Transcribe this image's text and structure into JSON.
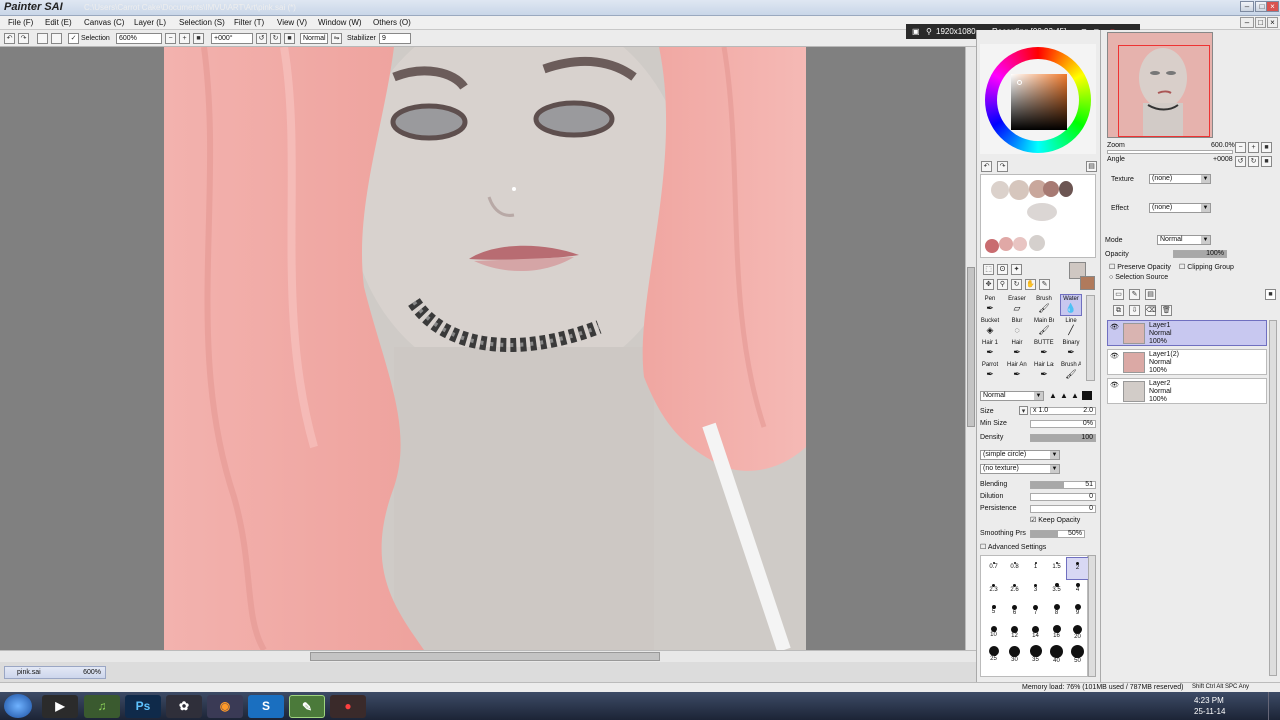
{
  "app": {
    "title": "Painter SAI",
    "path": "C:\\Users\\Carrot Cake\\Documents\\IMVU\\ART\\Art\\pink.sai (*)"
  },
  "menu": [
    "File (F)",
    "Edit (E)",
    "Canvas (C)",
    "Layer (L)",
    "Selection (S)",
    "Filter (T)",
    "View (V)",
    "Window (W)",
    "Others (O)"
  ],
  "toolbar": {
    "selection_label": "Selection",
    "zoom": "600%",
    "rotation": "+000°",
    "blend_mode": "Normal",
    "stabilizer_label": "Stabilizer",
    "stabilizer_value": "9"
  },
  "recording": {
    "resolution": "1920x1080",
    "status": "Recording [00:03:45]"
  },
  "navigator": {
    "zoom_label": "Zoom",
    "zoom_value": "600.0%",
    "angle_label": "Angle",
    "angle_value": "+0008"
  },
  "layer_props": {
    "texture_label": "Texture",
    "texture_value": "(none)",
    "effect_label": "Effect",
    "effect_value": "(none)",
    "mode_label": "Mode",
    "mode_value": "Normal",
    "opacity_label": "Opacity",
    "opacity_value": "100%",
    "opacity_level": 1.0,
    "preserve_opacity": "Preserve Opacity",
    "clipping_group": "Clipping Group",
    "selection_source": "Selection Source"
  },
  "layers": [
    {
      "name": "Layer1",
      "mode": "Normal",
      "opacity": "100%",
      "selected": true
    },
    {
      "name": "Layer1(2)",
      "mode": "Normal",
      "opacity": "100%",
      "selected": false
    },
    {
      "name": "Layer2",
      "mode": "Normal",
      "opacity": "100%",
      "selected": false
    }
  ],
  "tools": [
    {
      "label": "Pen",
      "icon": "pen-icon"
    },
    {
      "label": "Eraser",
      "icon": "eraser-icon"
    },
    {
      "label": "Brush",
      "icon": "brush-icon"
    },
    {
      "label": "Water",
      "icon": "water-icon"
    },
    {
      "label": "Bucket",
      "icon": "bucket-icon"
    },
    {
      "label": "Blur",
      "icon": "blur-icon"
    },
    {
      "label": "Main Br.",
      "icon": "brush-icon"
    },
    {
      "label": "Line",
      "icon": "line-icon"
    },
    {
      "label": "Hair 1",
      "icon": "pen-icon"
    },
    {
      "label": "Hair",
      "icon": "pen-icon"
    },
    {
      "label": "BUTTER",
      "icon": "pen-icon"
    },
    {
      "label": "Binary",
      "icon": "pen-icon"
    },
    {
      "label": "Parrot",
      "icon": "pen-icon"
    },
    {
      "label": "Hair Anime",
      "icon": "pen-icon"
    },
    {
      "label": "Hair Lash",
      "icon": "pen-icon"
    },
    {
      "label": "Brush Adde",
      "icon": "brush-icon"
    }
  ],
  "brush": {
    "mode": "Normal",
    "size_label": "Size",
    "size_multiplier": "x 1.0",
    "size_value": "2.0",
    "min_size_label": "Min Size",
    "min_size_value": "0%",
    "density_label": "Density",
    "density_value": "100",
    "shape": "(simple circle)",
    "texture": "(no texture)",
    "blending_label": "Blending",
    "blending_value": "51",
    "dilution_label": "Dilution",
    "dilution_value": "0",
    "persistence_label": "Persistence",
    "persistence_value": "0",
    "keep_opacity": "Keep Opacity",
    "smoothing_label": "Smoothing Prs",
    "smoothing_value": "50%",
    "advanced": "Advanced Settings"
  },
  "brush_sizes": [
    "0.7",
    "0.8",
    "1",
    "1.5",
    "2",
    "2.3",
    "2.6",
    "3",
    "3.5",
    "4",
    "5",
    "6",
    "7",
    "8",
    "9",
    "10",
    "12",
    "14",
    "16",
    "20",
    "25",
    "30",
    "35",
    "40",
    "50"
  ],
  "file_tab": {
    "name": "pink.sai",
    "zoom": "600%"
  },
  "status": {
    "memory": "Memory load: 76% (101MB used / 787MB reserved)",
    "keys": "Shift Ctrl Alt SPC Any"
  },
  "clock": {
    "time": "4:23 PM",
    "date": "25-11-14"
  },
  "taskbar_apps": [
    "Start",
    "Media",
    "Spotify",
    "Photoshop",
    "App",
    "Firefox",
    "Skype",
    "SAI",
    "Recorder"
  ],
  "colors": {
    "hair": "#f2a9a6",
    "skin": "#d6d0cc",
    "selected_layer": "#c8c8f0"
  }
}
